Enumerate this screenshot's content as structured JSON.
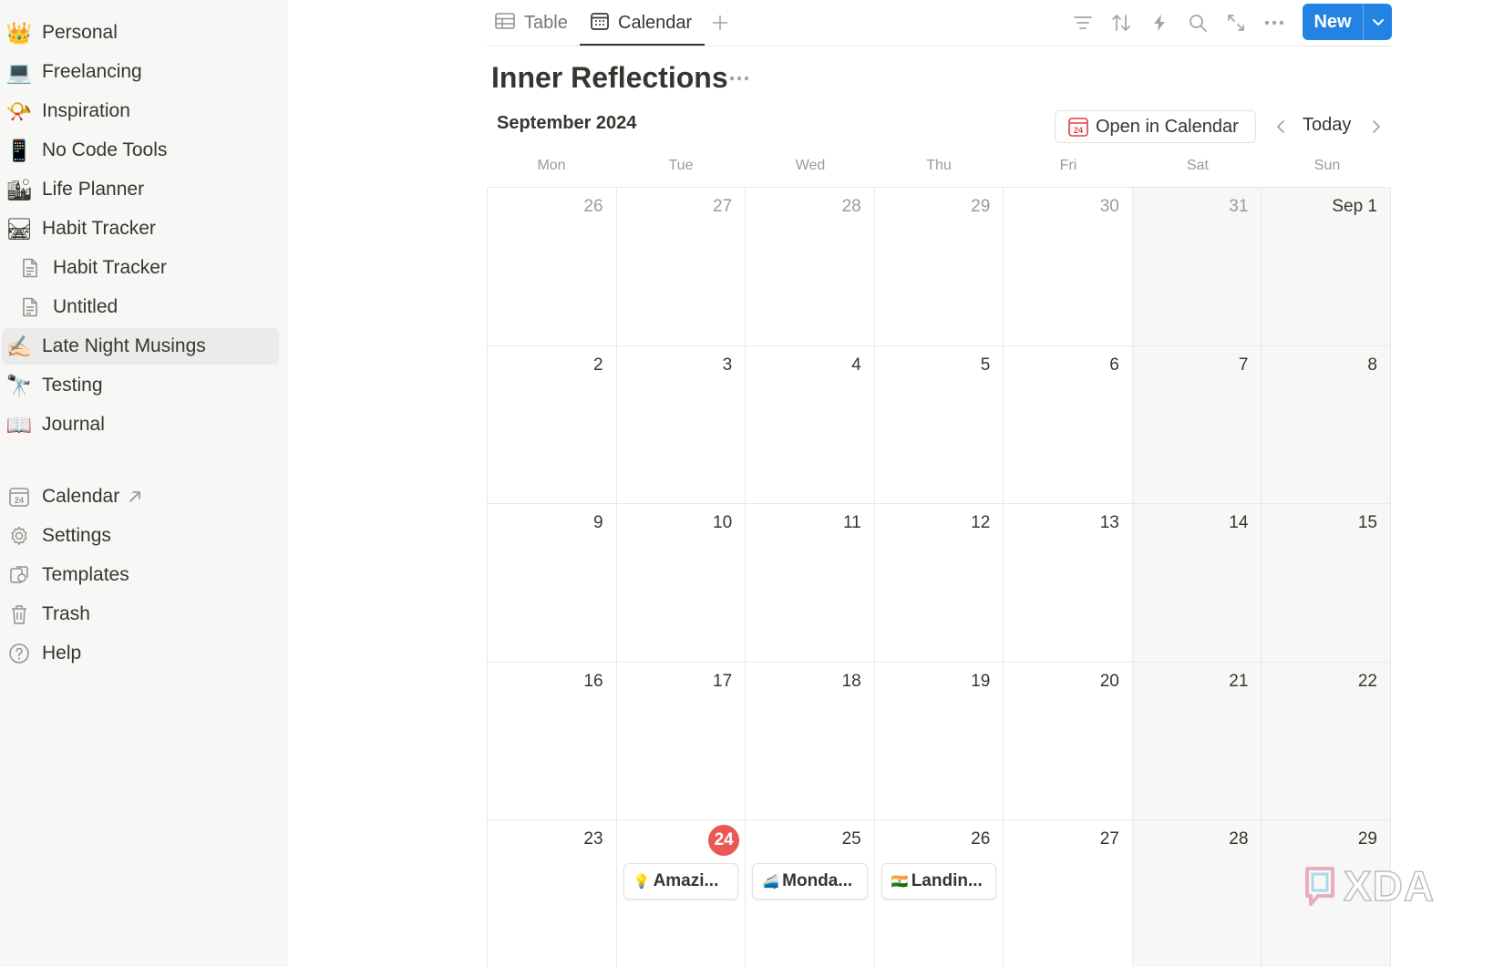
{
  "sidebar": {
    "items": [
      {
        "emoji": "👑",
        "label": "Personal"
      },
      {
        "emoji": "💻",
        "label": "Freelancing"
      },
      {
        "emoji": "📯",
        "label": "Inspiration"
      },
      {
        "emoji": "📱",
        "label": "No Code Tools"
      },
      {
        "emoji": "🏙",
        "label": "Life Planner"
      },
      {
        "emoji": "🛤",
        "label": "Habit Tracker"
      },
      {
        "icon": "page-icon",
        "label": "Habit Tracker"
      },
      {
        "icon": "page-icon",
        "label": "Untitled"
      },
      {
        "emoji": "✍🏻",
        "label": "Late Night Musings"
      },
      {
        "emoji": "🔭",
        "label": "Testing"
      },
      {
        "emoji": "📖",
        "label": "Journal"
      }
    ],
    "footer": [
      {
        "icon": "calendar-icon",
        "label": "Calendar",
        "calendar_icon_text": "24"
      },
      {
        "icon": "gear-icon",
        "label": "Settings"
      },
      {
        "icon": "templates-icon",
        "label": "Templates"
      },
      {
        "icon": "trash-icon",
        "label": "Trash"
      },
      {
        "icon": "help-icon",
        "label": "Help"
      }
    ]
  },
  "views": {
    "tabs": [
      {
        "icon": "table-icon",
        "label": "Table"
      },
      {
        "icon": "calendar-icon",
        "label": "Calendar"
      }
    ],
    "active": "Calendar"
  },
  "toolbar": {
    "new_label": "New"
  },
  "database": {
    "title": "Inner Reflections"
  },
  "calendar": {
    "month_label": "September 2024",
    "open_in_calendar_label": "Open in Calendar",
    "open_icon_text": "24",
    "today_label": "Today",
    "weekdays": [
      "Mon",
      "Tue",
      "Wed",
      "Thu",
      "Fri",
      "Sat",
      "Sun"
    ],
    "weeks": [
      [
        "26",
        "27",
        "28",
        "29",
        "30",
        "31",
        "Sep 1"
      ],
      [
        "2",
        "3",
        "4",
        "5",
        "6",
        "7",
        "8"
      ],
      [
        "9",
        "10",
        "11",
        "12",
        "13",
        "14",
        "15"
      ],
      [
        "16",
        "17",
        "18",
        "19",
        "20",
        "21",
        "22"
      ],
      [
        "23",
        "24",
        "25",
        "26",
        "27",
        "28",
        "29"
      ]
    ],
    "today": "24",
    "events": [
      {
        "day": "24",
        "emoji": "💡",
        "title": "Amazi..."
      },
      {
        "day": "25",
        "emoji": "🚄",
        "title": "Monda..."
      },
      {
        "day": "26",
        "emoji": "🇮🇳",
        "title": "Landin..."
      }
    ]
  },
  "watermark": {
    "text": "XDA"
  },
  "colors": {
    "accent": "#2383e2",
    "today_badge": "#eb5757",
    "sidebar_bg": "#f7f7f5",
    "weekend_bg": "#f7f7f5"
  }
}
